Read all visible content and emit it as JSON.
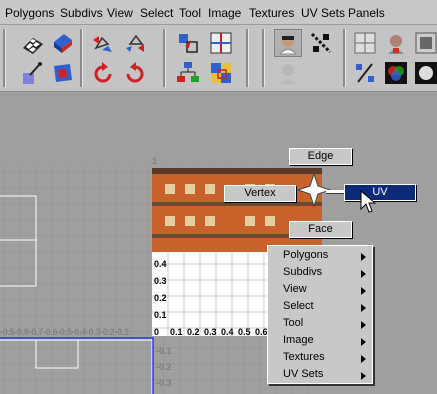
{
  "menubar": {
    "items": [
      "Polygons",
      "Subdivs",
      "View",
      "Select",
      "Tool",
      "Image",
      "Textures",
      "UV Sets",
      "Panels"
    ]
  },
  "toolbar": {
    "icons": [
      "checker-texture-icon",
      "shaded-uv-icon",
      "flip-uv-left-icon",
      "flip-uv-right-icon",
      "move-uv-icon",
      "grid-snap-icon",
      "portrait-icon",
      "diagonal-cut-icon",
      "grid-icon",
      "face-silhouette-icon",
      "smudge-uv-icon",
      "uv-layout-icon",
      "rotate-ccw-icon",
      "rotate-cw-icon",
      "tree-layout-icon",
      "checker-tile-icon",
      "face-gray-icon",
      "percent-icon",
      "rgb-channels-icon",
      "display-icon"
    ]
  },
  "viewport": {
    "axis_labels_top": [
      "1"
    ],
    "v_labels": [
      "0.4",
      "0.3",
      "0.2",
      "0.1"
    ],
    "v_neg_labels": [
      "-0.1",
      "-0.2",
      "-0.3"
    ],
    "u_labels": [
      "0.1",
      "0.2",
      "0.3",
      "0.4",
      "0.5",
      "0.6"
    ],
    "u_neg_labels_text": "-0.5-0.8-0.7-0.6-0.5-0.4-0.3-0.2-0.1",
    "zero_label": "0"
  },
  "marking_menu": {
    "edge": "Edge",
    "vertex": "Vertex",
    "uv": "UV",
    "face": "Face"
  },
  "submenu": {
    "items": [
      "Polygons",
      "Subdivs",
      "View",
      "Select",
      "Tool",
      "Image",
      "Textures",
      "UV Sets"
    ]
  },
  "colors": {
    "accent": "#0b2a7a",
    "texture": "#c8622a"
  }
}
